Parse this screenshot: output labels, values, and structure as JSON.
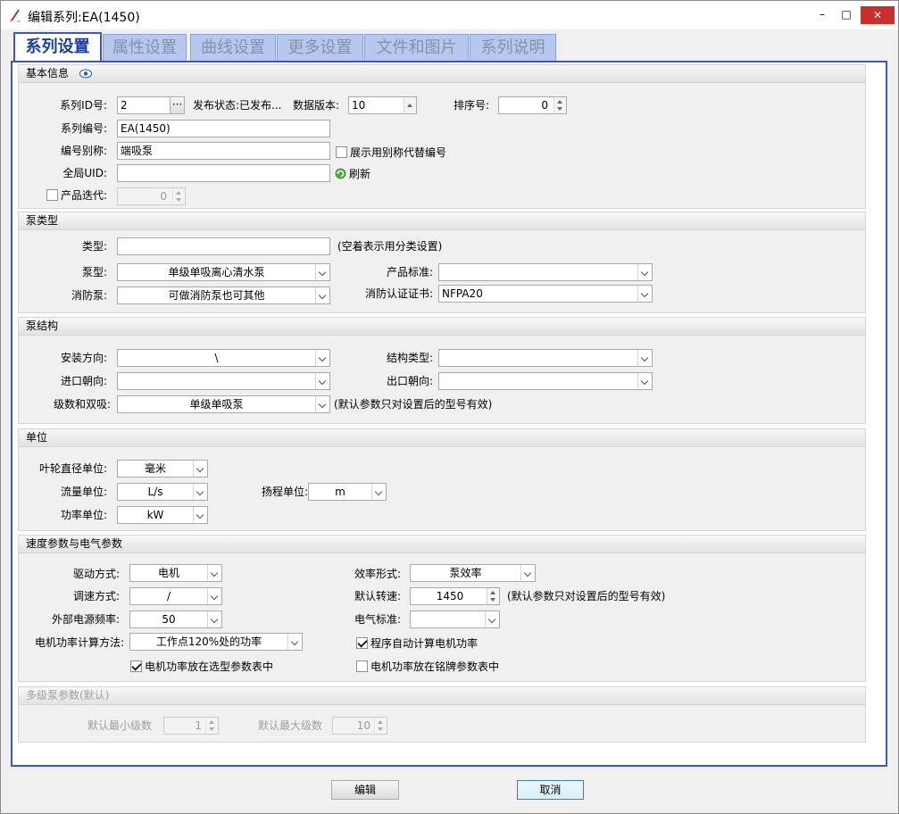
{
  "window": {
    "title": "编辑系列:EA(1450)",
    "min": "–",
    "max": "□",
    "close": "✕"
  },
  "tabs": [
    "系列设置",
    "属性设置",
    "曲线设置",
    "更多设置",
    "文件和图片",
    "系列说明"
  ],
  "basic": {
    "header": "基本信息",
    "series_id_label": "系列ID号:",
    "series_id": "2",
    "browse": "···",
    "publish_status": "发布状态:已发布...",
    "data_version_label": "数据版本:",
    "data_version": "10",
    "sort_label": "排序号:",
    "sort": "0",
    "code_label": "系列编号:",
    "code": "EA(1450)",
    "alias_label": "编号别称:",
    "alias": "端吸泵",
    "alias_check_label": "展示用别称代替编号",
    "uid_label": "全局UID:",
    "uid": "",
    "refresh": "刷新",
    "iter_label": "产品迭代:",
    "iter": "0"
  },
  "pumptype": {
    "header": "泵类型",
    "type_label": "类型:",
    "type_value": "",
    "type_hint": "(空着表示用分类设置)",
    "pump_label": "泵型:",
    "pump": "单级单吸离心清水泵",
    "standard_label": "产品标准:",
    "standard": "",
    "fire_label": "消防泵:",
    "fire": "可做消防泵也可其他",
    "cert_label": "消防认证证书:",
    "cert": "NFPA20"
  },
  "structure": {
    "header": "泵结构",
    "mount_label": "安装方向:",
    "mount": "\\",
    "struct_label": "结构类型:",
    "struct": "",
    "inlet_label": "进口朝向:",
    "inlet": "",
    "outlet_label": "出口朝向:",
    "outlet": "",
    "stage_label": "级数和双吸:",
    "stage": "单级单吸泵",
    "stage_hint": "(默认参数只对设置后的型号有效)"
  },
  "units": {
    "header": "单位",
    "dia_label": "叶轮直径单位:",
    "dia": "毫米",
    "flow_label": "流量单位:",
    "flow": "L/s",
    "head_label": "扬程单位:",
    "head": "m",
    "power_label": "功率单位:",
    "power": "kW"
  },
  "speed": {
    "header": "速度参数与电气参数",
    "drive_label": "驱动方式:",
    "drive": "电机",
    "eff_label": "效率形式:",
    "eff": "泵效率",
    "regulate_label": "调速方式:",
    "regulate": "/",
    "rpm_label": "默认转速:",
    "rpm": "1450",
    "rpm_hint": "(默认参数只对设置后的型号有效)",
    "freq_label": "外部电源频率:",
    "freq": "50",
    "elec_label": "电气标准:",
    "elec": "",
    "method_label": "电机功率计算方法:",
    "method": "工作点120%处的功率",
    "auto_label": "程序自动计算电机功率",
    "sel_label": "电机功率放在选型参数表中",
    "plate_label": "电机功率放在铭牌参数表中"
  },
  "multi": {
    "header": "多级泵参数(默认)",
    "min_label": "默认最小级数",
    "min": "1",
    "max_label": "默认最大级数",
    "max": "10"
  },
  "buttons": {
    "edit": "编辑",
    "cancel": "取消"
  }
}
